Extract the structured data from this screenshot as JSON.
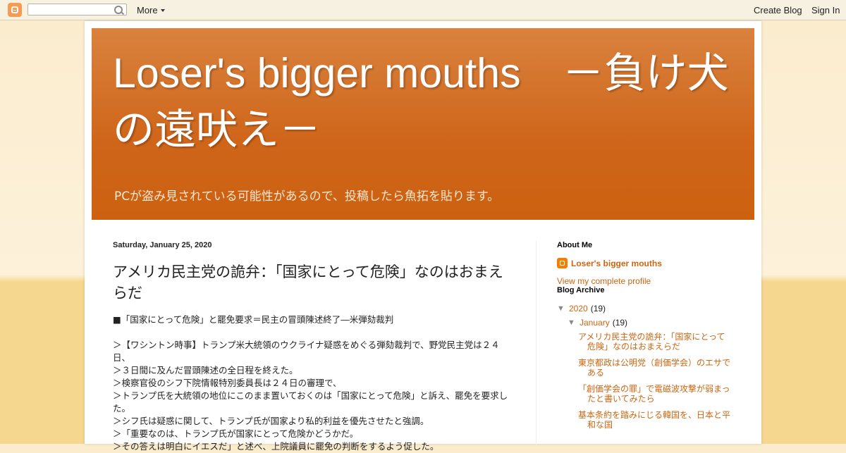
{
  "navbar": {
    "search_placeholder": "",
    "more_label": "More",
    "create_label": "Create Blog",
    "signin_label": "Sign In"
  },
  "header": {
    "title": "Loser's bigger mouths　－負け犬の遠吠え－",
    "description": "PCが盗み見されている可能性があるので、投稿したら魚拓を貼ります。"
  },
  "post": {
    "date": "Saturday, January 25, 2020",
    "title": "アメリカ民主党の詭弁：「国家にとって危険」なのはおまえらだ",
    "lines": [
      "■「国家にとって危険」と罷免要求＝民主の冒頭陳述終了―米弾劾裁判",
      "",
      "＞【ワシントン時事】トランプ米大統領のウクライナ疑惑をめぐる弾劾裁判で、野党民主党は２４日、",
      "＞３日間に及んだ冒頭陳述の全日程を終えた。",
      "＞検察官役のシフ下院情報特別委員長は２４日の審理で、",
      "＞トランプ氏を大統領の地位にこのまま置いておくのは「国家にとって危険」と訴え、罷免を要求した。",
      "＞シフ氏は疑惑に関して、トランプ氏が国家より私的利益を優先させたと強調。",
      "＞「重要なのは、トランプ氏が国家にとって危険かどうかだ。",
      "＞その答えは明白にイエスだ」と述べ、上院議員に罷免の判断をするよう促した。"
    ]
  },
  "sidebar": {
    "about_title": "About Me",
    "profile_name": "Loser's bigger mouths",
    "profile_link": "View my complete profile",
    "archive_title": "Blog Archive",
    "year": {
      "label": "2020",
      "count": "(19)",
      "arrow": "▼"
    },
    "month": {
      "label": "January",
      "count": "(19)",
      "arrow": "▼"
    },
    "posts": [
      "アメリカ民主党の詭弁：「国家にとって危険」なのはおまえらだ",
      "東京都政は公明党（創価学会）のエサである",
      "「創価学会の罪」で電磁波攻撃が弱まったと書いてみたら",
      "基本条約を踏みにじる韓国を、日本と平和な国"
    ]
  },
  "colors": {
    "accent": "#cc6611",
    "header_bg": "#cc6111",
    "page_bg": "#f5d790"
  }
}
